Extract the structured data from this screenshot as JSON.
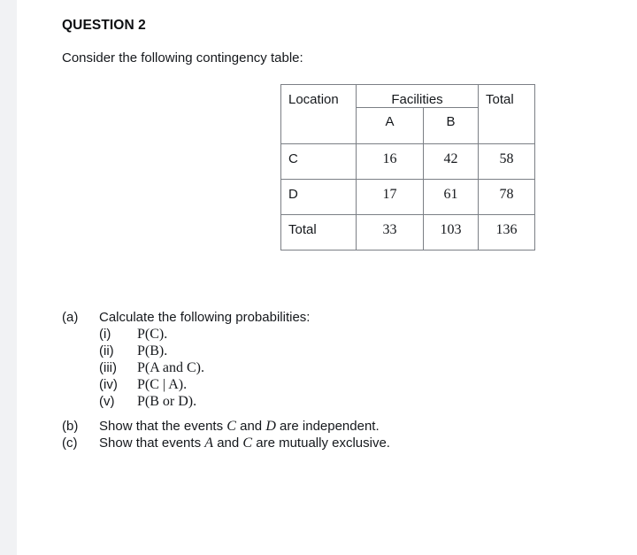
{
  "document": {
    "heading": "QUESTION 2",
    "intro": "Consider the following contingency table:"
  },
  "table": {
    "header": {
      "location": "Location",
      "facilities": "Facilities",
      "total": "Total",
      "sub_a": "A",
      "sub_b": "B"
    },
    "rows": [
      {
        "label": "C",
        "a": "16",
        "b": "42",
        "total": "58"
      },
      {
        "label": "D",
        "a": "17",
        "b": "61",
        "total": "78"
      },
      {
        "label": "Total",
        "a": "33",
        "b": "103",
        "total": "136"
      }
    ]
  },
  "questions": {
    "a": {
      "label": "(a)",
      "text": "Calculate the following probabilities:",
      "items": [
        {
          "label": "(i)",
          "expr": "P(C)."
        },
        {
          "label": "(ii)",
          "expr": "P(B)."
        },
        {
          "label": "(iii)",
          "expr": "P(A  and  C)."
        },
        {
          "label": "(iv)",
          "expr": "P(C | A)."
        },
        {
          "label": "(v)",
          "expr": "P(B or D)."
        }
      ]
    },
    "b": {
      "label": "(b)",
      "text_before": "Show that the events ",
      "var1": "C",
      "text_mid": " and ",
      "var2": "D",
      "text_after": " are independent."
    },
    "c": {
      "label": "(c)",
      "text_before": "Show that events ",
      "var1": "A",
      "text_mid": " and ",
      "var2": "C",
      "text_after": " are mutually exclusive."
    }
  }
}
